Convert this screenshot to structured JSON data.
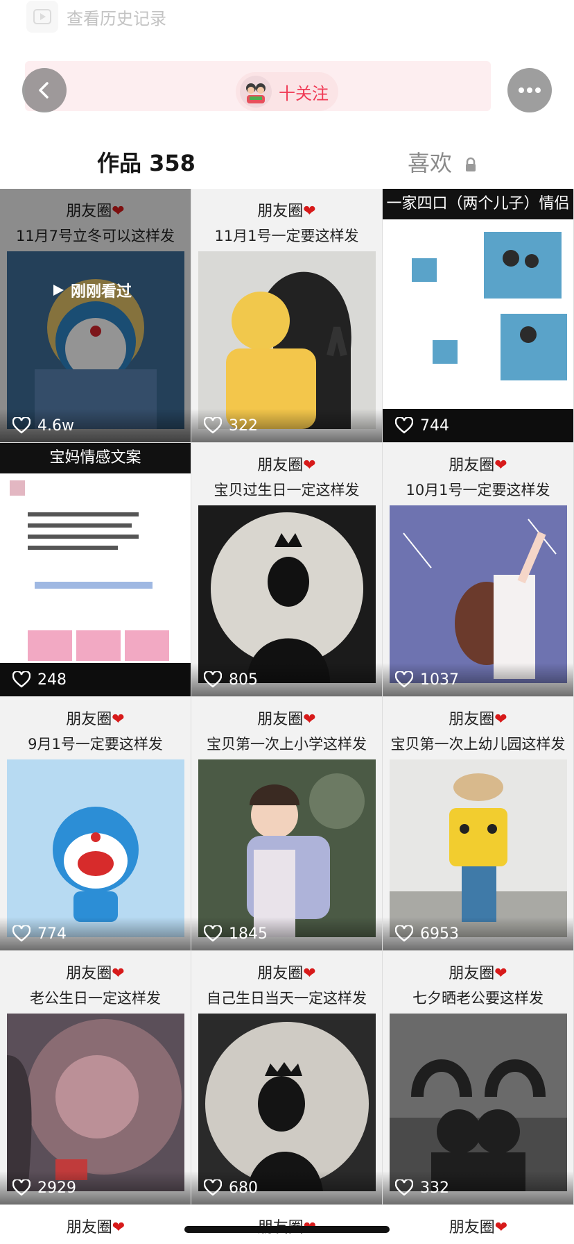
{
  "history_hint": {
    "label": "查看历史记录"
  },
  "header": {
    "follow_label": "十关注",
    "back_icon": "chevron-left-icon",
    "more_icon": "more-horizontal-icon"
  },
  "tabs": {
    "works_label": "作品 358",
    "likes_label": "喜欢"
  },
  "posts": [
    {
      "title": "朋友圈",
      "subtitle": "11月7号立冬可以这样发",
      "likes": "4.6w",
      "watched_label": "刚刚看过"
    },
    {
      "title": "朋友圈",
      "subtitle": "11月1号一定要这样发",
      "likes": "322"
    },
    {
      "banner": "一家四口（两个儿子）情侣头像",
      "likes": "744"
    },
    {
      "banner": "宝妈情感文案",
      "likes": "248"
    },
    {
      "title": "朋友圈",
      "subtitle": "宝贝过生日一定这样发",
      "likes": "805"
    },
    {
      "title": "朋友圈",
      "subtitle": "10月1号一定要这样发",
      "likes": "1037"
    },
    {
      "title": "朋友圈",
      "subtitle": "9月1号一定要这样发",
      "likes": "774"
    },
    {
      "title": "朋友圈",
      "subtitle": "宝贝第一次上小学这样发",
      "likes": "1845"
    },
    {
      "title": "朋友圈",
      "subtitle": "宝贝第一次上幼儿园这样发",
      "likes": "6953"
    },
    {
      "title": "朋友圈",
      "subtitle": "老公生日一定这样发",
      "likes": "2929"
    },
    {
      "title": "朋友圈",
      "subtitle": "自己生日当天一定这样发",
      "likes": "680"
    },
    {
      "title": "朋友圈",
      "subtitle": "七夕晒老公要这样发",
      "likes": "332"
    }
  ],
  "partial_row": [
    "朋友圈",
    "朋友圈",
    "朋友圈"
  ]
}
